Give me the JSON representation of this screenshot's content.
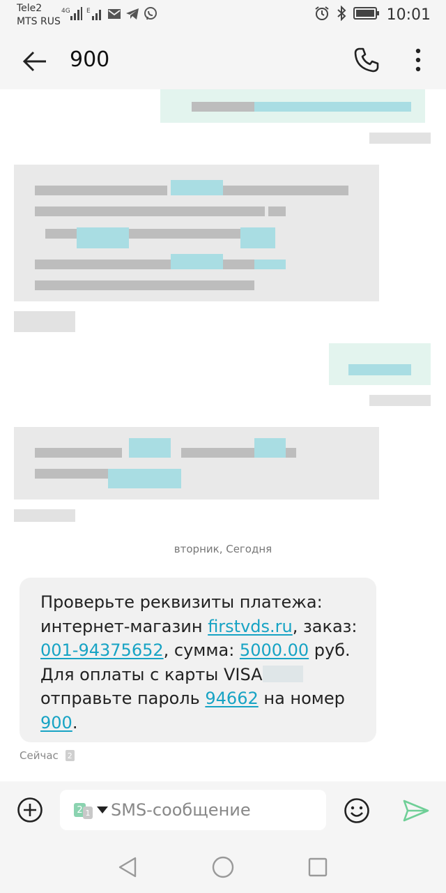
{
  "status_bar": {
    "operator_1": "Tele2",
    "operator_2": "MTS RUS",
    "network_1": "4G",
    "network_2": "E",
    "time": "10:01"
  },
  "app_bar": {
    "title": "900"
  },
  "thread": {
    "date_separator": "вторник, Сегодня",
    "last_message": {
      "line1": "Проверьте реквизиты платежа:",
      "line2_prefix": "интернет-магазин ",
      "shop_link": "firstvds.ru",
      "line2_suffix": ", заказ:",
      "order_link": "001-94375652",
      "line3_mid": ", сумма: ",
      "amount_link": "5000.00",
      "line3_suffix": " руб.",
      "line4": "Для оплаты с карты VISA",
      "line5_prefix": "отправьте пароль ",
      "code_link": "94662",
      "line5_suffix": " на номер",
      "number_link": "900",
      "line6_suffix": "."
    },
    "timestamp": "Сейчас",
    "sim_badge": "2"
  },
  "input_bar": {
    "placeholder": "SMS-сообщение",
    "sim_primary": "2",
    "sim_secondary": "1"
  },
  "colors": {
    "link": "#17a3c4",
    "send": "#6fcf97",
    "bubble": "#f1f1f1",
    "bar": "#f5f5f5"
  }
}
